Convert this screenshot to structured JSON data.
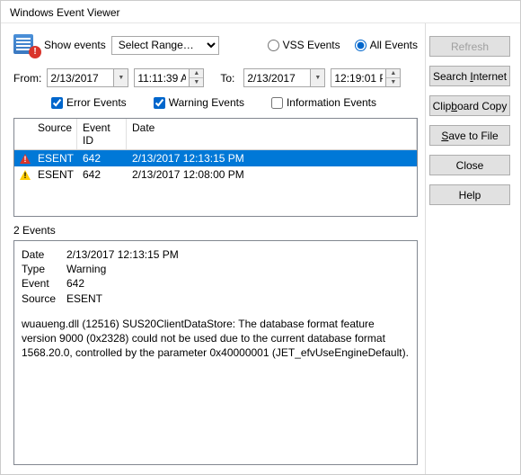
{
  "title": "Windows Event Viewer",
  "toolbar": {
    "show_events_label": "Show events",
    "range_select": "Select Range…",
    "radio_vss": "VSS Events",
    "radio_all": "All Events",
    "radio_selected": "all"
  },
  "range": {
    "from_label": "From:",
    "from_date": "2/13/2017",
    "from_time": "11:11:39 A",
    "to_label": "To:",
    "to_date": "2/13/2017",
    "to_time": "12:19:01 P"
  },
  "filters": {
    "error": {
      "label": "Error Events",
      "checked": true
    },
    "warning": {
      "label": "Warning Events",
      "checked": true
    },
    "information": {
      "label": "Information Events",
      "checked": false
    }
  },
  "columns": {
    "source": "Source",
    "event_id": "Event ID",
    "date": "Date"
  },
  "rows": [
    {
      "icon": "warning-red",
      "source": "ESENT",
      "event_id": "642",
      "date": "2/13/2017 12:13:15 PM",
      "selected": true
    },
    {
      "icon": "warning",
      "source": "ESENT",
      "event_id": "642",
      "date": "2/13/2017 12:08:00 PM",
      "selected": false
    }
  ],
  "count_label": "2 Events",
  "detail": {
    "date": {
      "k": "Date",
      "v": "2/13/2017 12:13:15 PM"
    },
    "type": {
      "k": "Type",
      "v": "Warning"
    },
    "event": {
      "k": "Event",
      "v": "642"
    },
    "source": {
      "k": "Source",
      "v": "ESENT"
    },
    "message": "wuaueng.dll (12516) SUS20ClientDataStore: The database format feature version 9000 (0x2328) could not be used due to the current database format 1568.20.0, controlled by the parameter 0x40000001 (JET_efvUseEngineDefault)."
  },
  "buttons": {
    "refresh": "Refresh",
    "search": "Search Internet",
    "clipboard": "Clipboard Copy",
    "save": "Save to File",
    "close": "Close",
    "help": "Help"
  }
}
